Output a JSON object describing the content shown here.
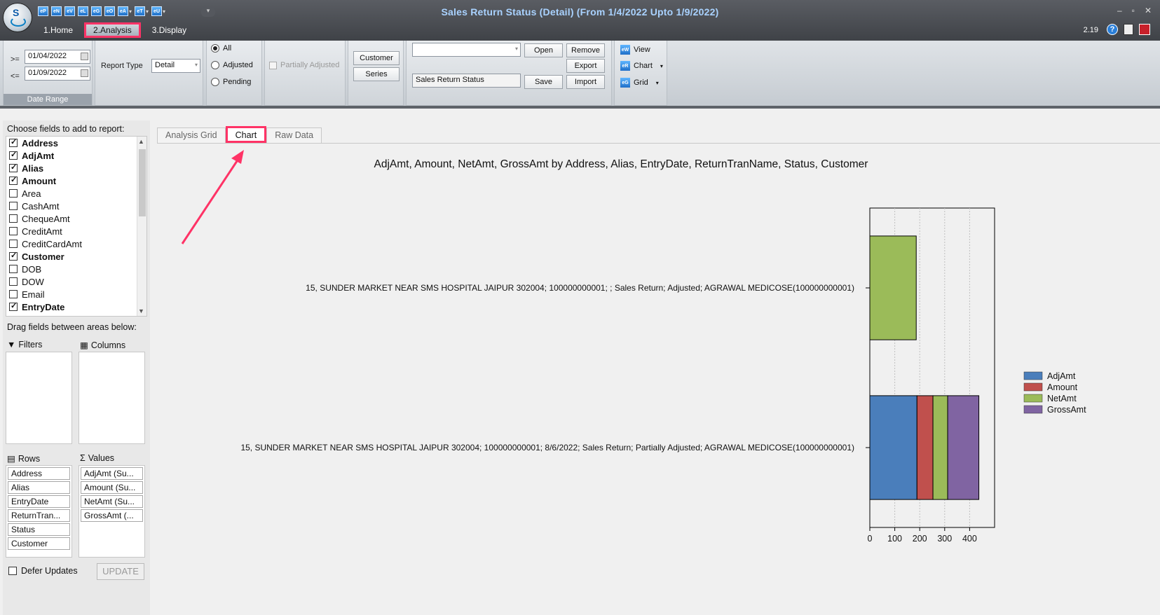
{
  "window": {
    "title": "Sales Return Status (Detail)  (From 1/4/2022 Upto 1/9/2022)",
    "version": "2.19",
    "controls": [
      "–",
      "▫",
      "✕"
    ]
  },
  "quick_access": [
    {
      "icon": "P",
      "label": "eP"
    },
    {
      "icon": "N",
      "label": "eN"
    },
    {
      "icon": "V",
      "label": "eV"
    },
    {
      "icon": "L",
      "label": "eL"
    },
    {
      "icon": "G",
      "label": "eG"
    },
    {
      "icon": "O",
      "label": "eO"
    },
    {
      "icon": "A",
      "label": "eA"
    },
    {
      "icon": "T",
      "label": "eT"
    },
    {
      "icon": "U",
      "label": "eU"
    }
  ],
  "menu_tabs": [
    {
      "label": "1.Home",
      "active": false
    },
    {
      "label": "2.Analysis",
      "active": true
    },
    {
      "label": "3.Display",
      "active": false
    }
  ],
  "ribbon": {
    "date_range": {
      "from_op": ">=",
      "from": "01/04/2022",
      "to_op": "<=",
      "to": "01/09/2022",
      "label": "Date Range"
    },
    "report_type": {
      "label": "Report Type",
      "value": "Detail"
    },
    "filter_options": [
      {
        "label": "All",
        "checked": true
      },
      {
        "label": "Adjusted",
        "checked": false
      },
      {
        "label": "Pending",
        "checked": false
      }
    ],
    "partially_adjusted": "Partially Adjusted",
    "customer_btn": "Customer",
    "series_btn": "Series",
    "layout_select": "",
    "layout_name": "Sales Return Status",
    "open_btn": "Open",
    "save_btn": "Save",
    "remove_btn": "Remove",
    "export_btn": "Export",
    "import_btn": "Import",
    "view_btn": "View",
    "chart_btn": "Chart",
    "grid_btn": "Grid"
  },
  "field_panel": {
    "title": "Choose fields to add to report:",
    "fields": [
      {
        "name": "Address",
        "checked": true
      },
      {
        "name": "AdjAmt",
        "checked": true
      },
      {
        "name": "Alias",
        "checked": true
      },
      {
        "name": "Amount",
        "checked": true
      },
      {
        "name": "Area",
        "checked": false
      },
      {
        "name": "CashAmt",
        "checked": false
      },
      {
        "name": "ChequeAmt",
        "checked": false
      },
      {
        "name": "CreditAmt",
        "checked": false
      },
      {
        "name": "CreditCardAmt",
        "checked": false
      },
      {
        "name": "Customer",
        "checked": true
      },
      {
        "name": "DOB",
        "checked": false
      },
      {
        "name": "DOW",
        "checked": false
      },
      {
        "name": "Email",
        "checked": false
      },
      {
        "name": "EntryDate",
        "checked": true
      }
    ],
    "drag_label": "Drag fields between areas below:",
    "filters_label": "Filters",
    "columns_label": "Columns",
    "rows_label": "Rows",
    "values_label": "Values",
    "rows": [
      "Address",
      "Alias",
      "EntryDate",
      "ReturnTran...",
      "Status",
      "Customer"
    ],
    "values": [
      "AdjAmt (Su...",
      "Amount (Su...",
      "NetAmt (Su...",
      "GrossAmt (..."
    ],
    "defer_label": "Defer Updates",
    "update_btn": "UPDATE"
  },
  "content_tabs": [
    {
      "label": "Analysis Grid",
      "active": false
    },
    {
      "label": "Chart",
      "active": true
    },
    {
      "label": "Raw Data",
      "active": false
    }
  ],
  "colors": {
    "AdjAmt": "#4a7ebb",
    "Amount": "#c0504d",
    "NetAmt": "#9bbb59",
    "GrossAmt": "#8064a2",
    "highlight": "#ff3366"
  },
  "chart_data": {
    "type": "bar",
    "orientation": "horizontal",
    "stacked": true,
    "title": "AdjAmt, Amount, NetAmt, GrossAmt by Address, Alias, EntryDate, ReturnTranName, Status, Customer",
    "categories": [
      "15, SUNDER MARKET NEAR SMS HOSPITAL JAIPUR 302004; 100000000001; ; Sales Return; Adjusted; AGRAWAL MEDICOSE(100000000001)",
      "15, SUNDER MARKET NEAR SMS HOSPITAL JAIPUR 302004; 100000000001; 8/6/2022; Sales Return; Partially Adjusted; AGRAWAL MEDICOSE(100000000001)"
    ],
    "series": [
      {
        "name": "AdjAmt",
        "values": [
          0,
          189
        ]
      },
      {
        "name": "Amount",
        "values": [
          0,
          64
        ]
      },
      {
        "name": "NetAmt",
        "values": [
          186,
          59
        ]
      },
      {
        "name": "GrossAmt",
        "values": [
          0,
          125
        ]
      }
    ],
    "xlim": [
      0,
      500
    ],
    "xticks": [
      0,
      100,
      200,
      300,
      400
    ],
    "grid": true,
    "legend": "right"
  }
}
